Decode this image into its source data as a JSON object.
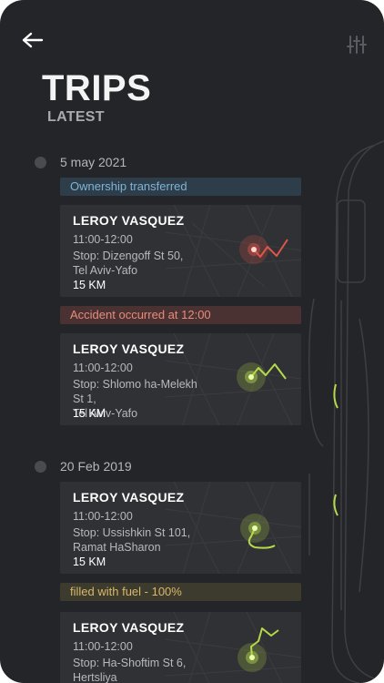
{
  "header": {
    "title": "TRIPS",
    "subtitle": "LATEST"
  },
  "timeline": [
    {
      "date": "5 may 2021",
      "events": [
        {
          "type": "pill",
          "style": "blue",
          "text": "Ownership transferred"
        },
        {
          "type": "trip",
          "name": "LEROY VASQUEZ",
          "time": "11:00-12:00",
          "stop_line1": "Stop: Dizengoff St 50,",
          "stop_line2": "Tel Aviv-Yafo",
          "distance": "15 KM",
          "route_color": "#e0544a"
        },
        {
          "type": "pill",
          "style": "red",
          "text": "Accident occurred at 12:00"
        },
        {
          "type": "trip",
          "name": "LEROY VASQUEZ",
          "time": "11:00-12:00",
          "stop_line1": "Stop: Shlomo ha-Melekh St 1,",
          "stop_line2": "Tel Aviv-Yafo",
          "distance": "15 KM",
          "route_color": "#b6d94a"
        }
      ]
    },
    {
      "date": "20 Feb 2019",
      "events": [
        {
          "type": "trip",
          "name": "LEROY VASQUEZ",
          "time": "11:00-12:00",
          "stop_line1": "Stop: Ussishkin St 101,",
          "stop_line2": "Ramat HaSharon",
          "distance": "15 KM",
          "route_color": "#b6d94a"
        },
        {
          "type": "pill",
          "style": "amber",
          "text": "filled with fuel  - 100%"
        },
        {
          "type": "trip",
          "name": "LEROY VASQUEZ",
          "time": "11:00-12:00",
          "stop_line1": "Stop: Ha-Shoftim St 6,",
          "stop_line2": "Hertsliya",
          "distance": "",
          "route_color": "#b6d94a"
        }
      ]
    }
  ],
  "icons": {
    "back": "arrow-left-icon",
    "filter": "sliders-icon"
  },
  "colors": {
    "background": "#242528",
    "card": "#303134",
    "accent_green": "#b6d94a",
    "accent_red": "#e0544a"
  }
}
